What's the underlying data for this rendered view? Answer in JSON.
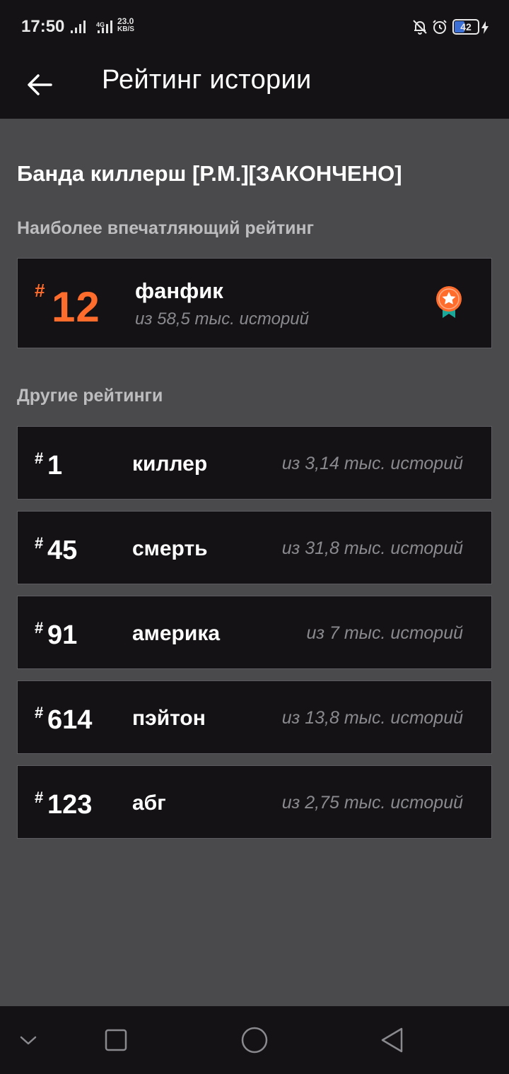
{
  "status_bar": {
    "time": "17:50",
    "network": "4G",
    "speed_value": "23.0",
    "speed_unit": "KB/S",
    "battery": "42",
    "battery_level": 0.42
  },
  "app_bar": {
    "back_icon": "arrow-left-icon",
    "title": "Рейтинг истории"
  },
  "story": {
    "title": "Банда киллерш [Р.М.][ЗАКОНЧЕНО]"
  },
  "top_rating": {
    "section_label": "Наиболее впечатляющий рейтинг",
    "hash": "#",
    "rank": "12",
    "tag": "фанфик",
    "count": "из 58,5 тыс. историй",
    "icon": "medal-star-icon",
    "accent_color": "#ff6c2c"
  },
  "other_ratings": {
    "section_label": "Другие рейтинги",
    "items": [
      {
        "hash": "#",
        "rank": "1",
        "tag": "киллер",
        "count": "из 3,14 тыс. историй"
      },
      {
        "hash": "#",
        "rank": "45",
        "tag": "смерть",
        "count": "из 31,8 тыс. историй"
      },
      {
        "hash": "#",
        "rank": "91",
        "tag": "америка",
        "count": "из 7 тыс. историй"
      },
      {
        "hash": "#",
        "rank": "614",
        "tag": "пэйтон",
        "count": "из 13,8 тыс. историй"
      },
      {
        "hash": "#",
        "rank": "123",
        "tag": "абг",
        "count": "из 2,75 тыс. историй"
      }
    ]
  },
  "nav_bar": {
    "icons": [
      "chevron-down-icon",
      "square-icon",
      "circle-icon",
      "triangle-back-icon"
    ]
  }
}
